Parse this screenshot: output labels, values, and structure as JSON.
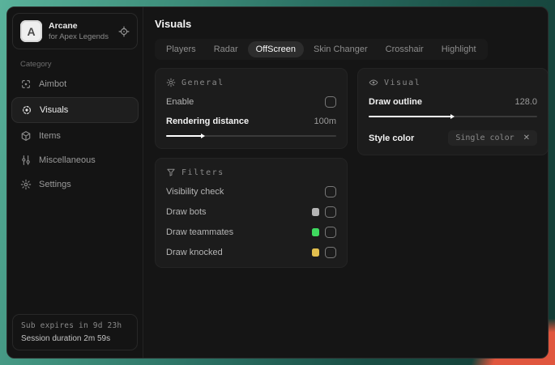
{
  "sidebar": {
    "brand": {
      "logo_letter": "A",
      "title": "Arcane",
      "subtitle": "for Apex Legends"
    },
    "category_label": "Category",
    "items": [
      {
        "label": "Aimbot"
      },
      {
        "label": "Visuals"
      },
      {
        "label": "Items"
      },
      {
        "label": "Miscellaneous"
      },
      {
        "label": "Settings"
      }
    ],
    "footer": {
      "sub_expires": "Sub expires in 9d 23h",
      "session_duration": "Session duration 2m 59s"
    }
  },
  "main": {
    "title": "Visuals",
    "tabs": [
      {
        "label": "Players"
      },
      {
        "label": "Radar"
      },
      {
        "label": "OffScreen"
      },
      {
        "label": "Skin Changer"
      },
      {
        "label": "Crosshair"
      },
      {
        "label": "Highlight"
      }
    ],
    "active_tab": "OffScreen",
    "general": {
      "title": "General",
      "enable_label": "Enable",
      "rendering_label": "Rendering distance",
      "rendering_value": "100m",
      "rendering_fill_pct": 21
    },
    "filters": {
      "title": "Filters",
      "rows": [
        {
          "label": "Visibility check"
        },
        {
          "label": "Draw bots",
          "swatch": "#b4b4b4"
        },
        {
          "label": "Draw teammates",
          "swatch": "#3fd95f"
        },
        {
          "label": "Draw knocked",
          "swatch": "#e2bf4e"
        }
      ]
    },
    "visual": {
      "title": "Visual",
      "outline_label": "Draw outline",
      "outline_value": "128.0",
      "outline_fill_pct": 49,
      "style_label": "Style color",
      "style_value": "Single color",
      "style_clear": "✕"
    }
  }
}
